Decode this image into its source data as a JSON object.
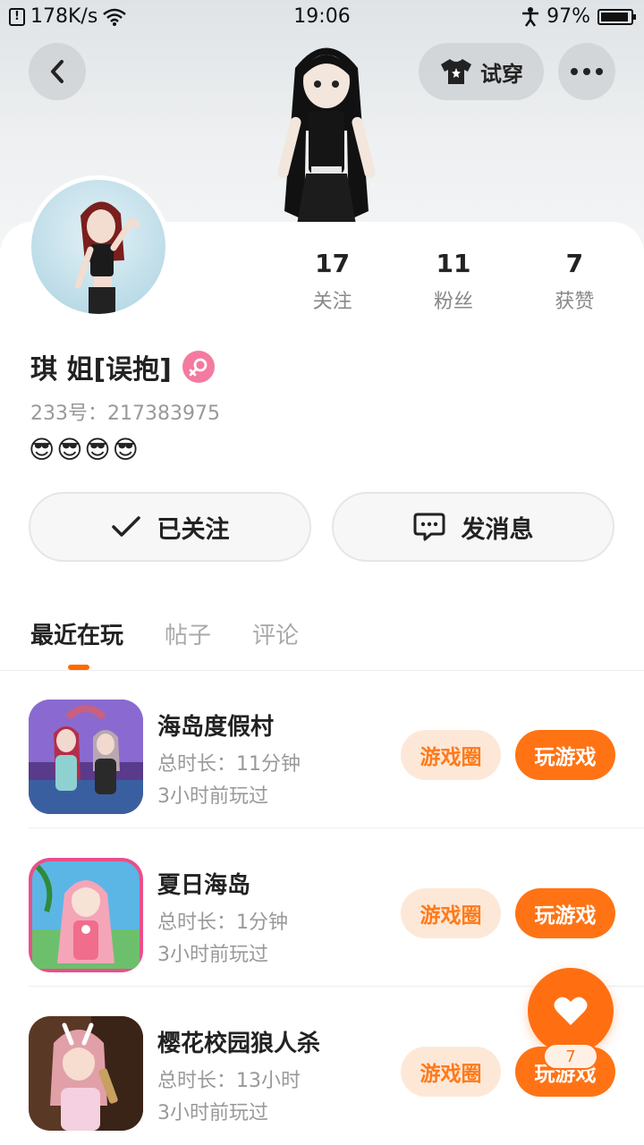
{
  "status_bar": {
    "speed": "178K/s",
    "time": "19:06",
    "battery": "97%"
  },
  "header": {
    "back_icon": "chevron-left-icon",
    "try_on_label": "试穿",
    "more_icon": "more-horizontal-icon"
  },
  "profile": {
    "following_count": "17",
    "following_label": "关注",
    "fans_count": "11",
    "fans_label": "粉丝",
    "likes_count": "7",
    "likes_label": "获赞",
    "name": "琪 姐[误抱]",
    "gender": "female",
    "uid": "233号：217383975",
    "bio_emoji": [
      "😎",
      "😎",
      "😎",
      "😎"
    ]
  },
  "actions": {
    "follow_label": "已关注",
    "message_label": "发消息"
  },
  "tabs": [
    {
      "label": "最近在玩",
      "active": true
    },
    {
      "label": "帖子",
      "active": false
    },
    {
      "label": "评论",
      "active": false
    }
  ],
  "games": [
    {
      "title": "海岛度假村",
      "duration": "总时长：11分钟",
      "last_played": "3小时前玩过",
      "circle_label": "游戏圈",
      "play_label": "玩游戏"
    },
    {
      "title": "夏日海岛",
      "duration": "总时长：1分钟",
      "last_played": "3小时前玩过",
      "circle_label": "游戏圈",
      "play_label": "玩游戏"
    },
    {
      "title": "樱花校园狼人杀",
      "duration": "总时长：13小时",
      "last_played": "3小时前玩过",
      "circle_label": "游戏圈",
      "play_label": "玩游戏"
    }
  ],
  "like_fab": {
    "count": "7"
  },
  "colors": {
    "accent": "#ff7314",
    "accent_soft": "#fde8d8",
    "gender_badge": "#f47aa0"
  }
}
